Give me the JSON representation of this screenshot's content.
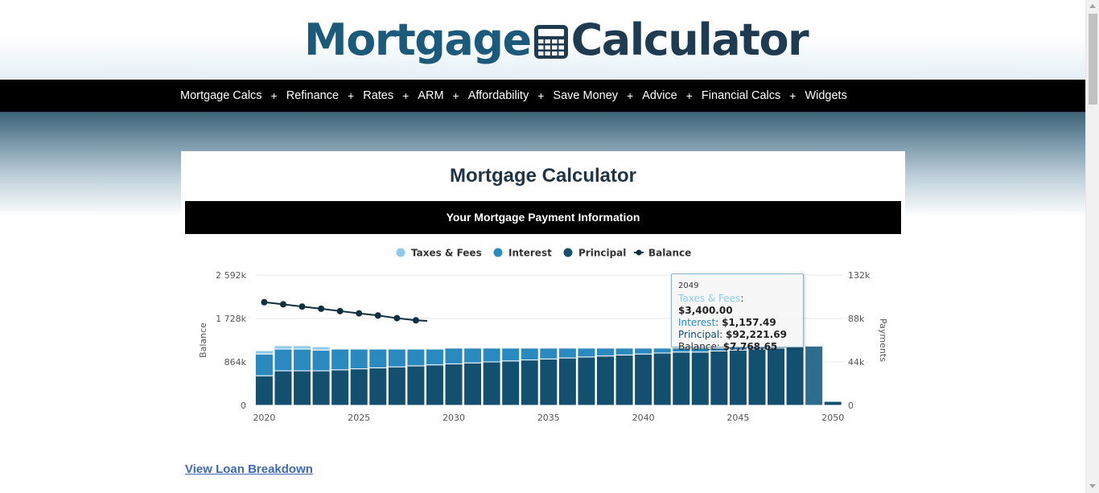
{
  "logo": {
    "word1": "Mortgage",
    "word2": "Calculator",
    "icon": "calculator-icon"
  },
  "nav": {
    "items": [
      "Mortgage Calcs",
      "Refinance",
      "Rates",
      "ARM",
      "Affordability",
      "Save Money",
      "Advice",
      "Financial Calcs",
      "Widgets"
    ],
    "separator": "+"
  },
  "main": {
    "title": "Mortgage Calculator",
    "info_bar": "Your Mortgage Payment Information",
    "breakdown_link": "View Loan Breakdown"
  },
  "colors": {
    "taxes": "#8fcbea",
    "interest": "#2a8ac0",
    "principal": "#13506f",
    "balance": "#0f3040",
    "nav_bg": "#000000",
    "logo_blue": "#1b5a7a",
    "logo_dark": "#1e3b52"
  },
  "tooltip": {
    "year": "2049",
    "taxes_label": "Taxes & Fees",
    "taxes_value": "$3,400.00",
    "interest_label": "Interest",
    "interest_value": "$1,157.49",
    "principal_label": "Principal",
    "principal_value": "$92,221.69",
    "balance_label": "Balance",
    "balance_value": "$7,768.65"
  },
  "chart_data": {
    "type": "bar",
    "legend": [
      "Taxes & Fees",
      "Interest",
      "Principal",
      "Balance"
    ],
    "legend_position": "top-center",
    "x_ticks": [
      "2020",
      "2025",
      "2030",
      "2035",
      "2040",
      "2045",
      "2050"
    ],
    "y_left": {
      "label": "Balance",
      "ticks": [
        "0",
        "864k",
        "1 728k",
        "2 592k"
      ],
      "range": [
        0,
        2592
      ]
    },
    "y_right": {
      "label": "Payments",
      "ticks": [
        "0",
        "44k",
        "88k",
        "132k"
      ],
      "range": [
        0,
        132
      ]
    },
    "years": [
      2020,
      2021,
      2022,
      2023,
      2024,
      2025,
      2026,
      2027,
      2028,
      2029,
      2030,
      2031,
      2032,
      2033,
      2034,
      2035,
      2036,
      2037,
      2038,
      2039,
      2040,
      2041,
      2042,
      2043,
      2044,
      2045,
      2046,
      2047,
      2048,
      2049,
      2050
    ],
    "series": [
      {
        "name": "Principal",
        "axis": "payments_k",
        "values": [
          30,
          35,
          35,
          35,
          36,
          37,
          38,
          39,
          40,
          41,
          42,
          43,
          44,
          45,
          46,
          47,
          48,
          49,
          50,
          51,
          52,
          53,
          54,
          54,
          55,
          56,
          57,
          58,
          59,
          60,
          4
        ]
      },
      {
        "name": "Interest",
        "axis": "payments_k",
        "values": [
          22,
          22,
          22,
          21,
          21,
          20,
          19,
          18,
          17,
          16,
          16,
          15,
          14,
          13,
          12,
          11,
          10,
          9,
          8,
          7,
          6,
          5,
          4,
          4,
          3,
          3,
          2,
          2,
          2,
          0,
          0
        ]
      },
      {
        "name": "Taxes & Fees",
        "axis": "payments_k",
        "values": [
          3.4,
          3.4,
          3.4,
          3.4,
          0,
          0,
          0,
          0,
          0,
          0,
          0,
          0,
          0,
          0,
          0,
          0,
          0,
          0,
          0,
          0,
          0,
          0,
          0,
          0,
          0,
          0,
          0,
          0,
          0,
          0,
          0
        ]
      },
      {
        "name": "Balance",
        "axis": "balance_k",
        "type": "line",
        "x": [
          2020,
          2021,
          2022,
          2023,
          2024,
          2025,
          2026,
          2027,
          2028,
          2028.6
        ],
        "values": [
          2052,
          2010,
          1965,
          1922,
          1875,
          1830,
          1788,
          1735,
          1692,
          1680
        ]
      }
    ]
  }
}
